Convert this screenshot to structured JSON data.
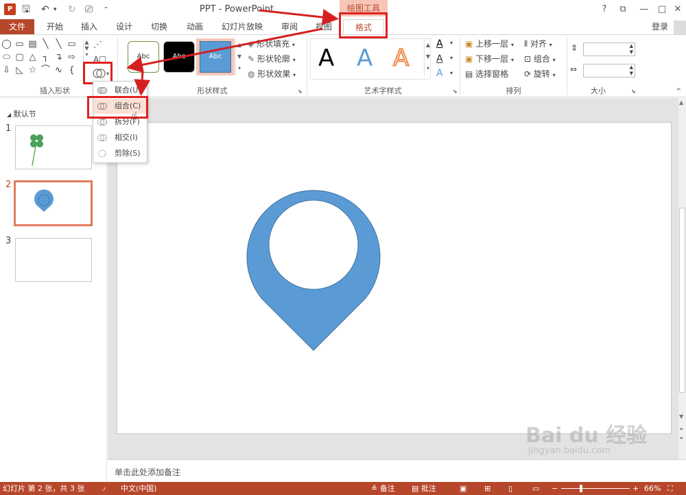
{
  "window": {
    "title": "PPT - PowerPoint",
    "app_icon": "P",
    "contextual_tab": "绘图工具",
    "controls": [
      "?",
      "⧉",
      "—",
      "□",
      "✕"
    ]
  },
  "tabs": {
    "file": "文件",
    "items": [
      "开始",
      "插入",
      "设计",
      "切换",
      "动画",
      "幻灯片放映",
      "审阅",
      "视图"
    ],
    "active": "格式",
    "login": "登录"
  },
  "ribbon": {
    "insert_shapes": {
      "label": "插入形状"
    },
    "shape_styles": {
      "label": "形状样式",
      "swatch_text": "Abc",
      "fill": "形状填充",
      "outline": "形状轮廓",
      "effects": "形状效果"
    },
    "wordart": {
      "label": "艺术字样式",
      "letter": "A"
    },
    "arrange": {
      "label": "排列",
      "bring_forward": "上移一层",
      "send_backward": "下移一层",
      "selection_pane": "选择窗格",
      "align": "对齐",
      "group": "组合",
      "rotate": "旋转"
    },
    "size": {
      "label": "大小"
    }
  },
  "merge_menu": {
    "items": [
      "联合(U)",
      "组合(C)",
      "拆分(F)",
      "相交(I)",
      "剪除(S)"
    ],
    "highlighted": "组合(C)"
  },
  "slide_pane": {
    "section": "默认节",
    "slides": [
      "1",
      "2",
      "3"
    ],
    "selected": "2"
  },
  "notes": {
    "placeholder": "单击此处添加备注"
  },
  "status": {
    "slide_info": "幻灯片 第 2 张，共 3 张",
    "language": "中文(中国)",
    "notes": "备注",
    "comments": "批注",
    "zoom": "66%"
  },
  "watermark": {
    "logo": "Bai du 经验",
    "url": "jingyan.baidu.com"
  },
  "colors": {
    "accent": "#b7472a",
    "shape_fill": "#5b9bd5",
    "highlight_box": "#e02020"
  }
}
